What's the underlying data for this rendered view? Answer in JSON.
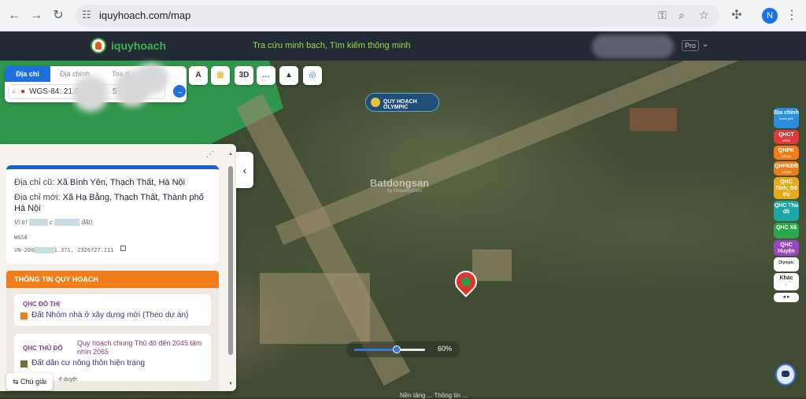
{
  "browser": {
    "url": "iquyhoach.com/map",
    "profile_initial": "N",
    "icons": [
      "back-icon",
      "forward-icon",
      "reload-icon",
      "site-info-icon",
      "password-key-icon",
      "zoom-icon",
      "star-icon",
      "extensions-icon",
      "menu-icon"
    ]
  },
  "header": {
    "logo_text": "iquyhoach",
    "tagline": "Tra cứu minh bạch, Tìm kiếm thông minh",
    "pro_label": "Pro"
  },
  "search": {
    "tabs": [
      {
        "label": "Địa chỉ",
        "active": true
      },
      {
        "label": "Địa chính",
        "active": false
      },
      {
        "label": "Toạ đ",
        "active": false
      }
    ],
    "input_value": "WGS-84: 21.0",
    "input_suffix": "5"
  },
  "toolbar": {
    "buttons": [
      {
        "name": "measure-button",
        "label": "A"
      },
      {
        "name": "map-layers-button",
        "label": "▦"
      },
      {
        "name": "3d-button",
        "label": "3D"
      },
      {
        "name": "comment-button",
        "label": "…"
      },
      {
        "name": "compass-button",
        "label": "▲"
      },
      {
        "name": "locate-button",
        "label": "◎"
      }
    ]
  },
  "map": {
    "olympic_badge": "QUY HOẠCH OLYMPIC",
    "watermark": "Batdongsan",
    "watermark_sub": "by PropertyGuru",
    "opacity_percent": 60,
    "opacity_label": "60%",
    "bottom_note": "Nền tảng ... Thông tin ..."
  },
  "info": {
    "old_address_label": "Địa chỉ cũ:",
    "old_address": "Xã Bình Yên, Thạch Thất, Hà Nội",
    "new_address_label": "Địa chỉ mới:",
    "new_address": "Xã Hạ Bằng, Thạch Thất, Thành phố Hà Nội",
    "position_note_start": "Vị trí",
    "position_note_mid": "c",
    "position_note_end": "đất).",
    "wgs_label": "WGS8",
    "vn2000_prefix": "VN-200",
    "vn2000_coords": "1.371, 2326727.111"
  },
  "planning": {
    "header": "THÔNG TIN QUY HOẠCH",
    "cards": [
      {
        "tag": "QHC ĐÔ THỊ",
        "title": "",
        "value": "Đất Nhóm nhà ở xây dựng mới (Theo dự án)",
        "color": "#ef7d1a"
      },
      {
        "tag": "QHC THỦ ĐÔ",
        "title": "Quy hoạch chung Thủ đô đến 2045 tầm nhìn 2065",
        "value": "Đất dân cư nông thôn hiện trạng",
        "color": "#7a6a2a"
      }
    ]
  },
  "guide": {
    "label": "Chú giải",
    "sub": "ê duyệt"
  },
  "layers": [
    {
      "label": "Địa chính",
      "sub": "mạnh giới",
      "color": "#2a8ee0"
    },
    {
      "label": "QHCT",
      "sub": "1/500",
      "color": "#e03a3a"
    },
    {
      "label": "QHPK",
      "sub": "1/2000",
      "color": "#ef7d1a"
    },
    {
      "label": "QHPKĐB",
      "sub": "1/2000",
      "color": "#ef7d1a"
    },
    {
      "label": "QHC Tỉnh, Đô thị",
      "sub": "",
      "color": "#e8a91a"
    },
    {
      "label": "QHC Thủ đô",
      "sub": "",
      "color": "#1ba7a7"
    },
    {
      "label": "QHC Xã",
      "sub": "",
      "color": "#2aa84a"
    },
    {
      "label": "QHC Huyện",
      "sub": "",
      "color": "#9a45c8"
    },
    {
      "label": "Olympic",
      "sub": "",
      "color": "#ffffff"
    },
    {
      "label": "Khác",
      "sub": "",
      "color": "#ffffff"
    }
  ],
  "layer_pager": "◂ ▸"
}
